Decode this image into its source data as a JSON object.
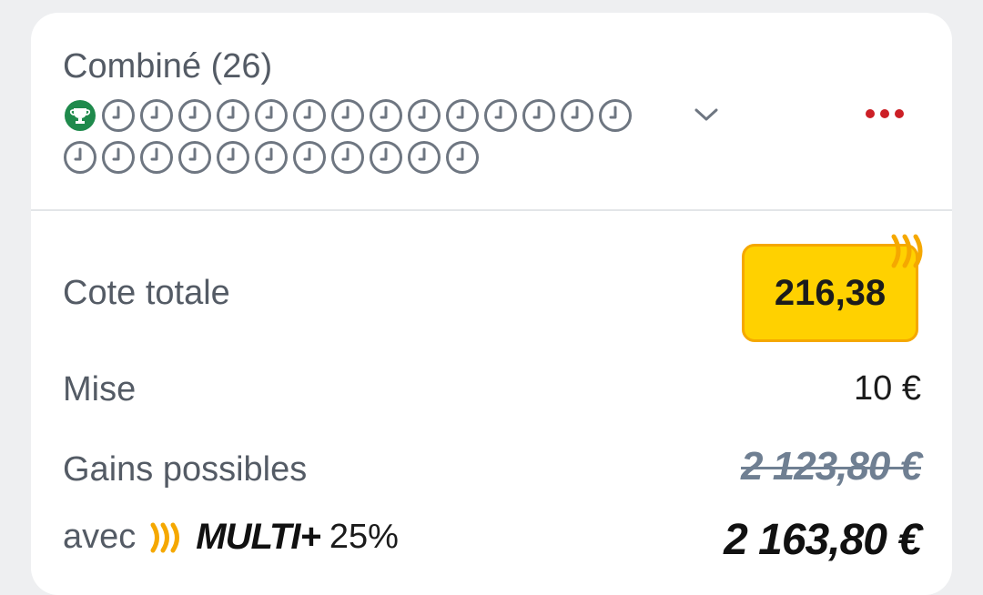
{
  "slip": {
    "title": "Combiné (26)",
    "status_rows": [
      [
        "trophy-icon",
        "clock-icon",
        "clock-icon",
        "clock-icon",
        "clock-icon",
        "clock-icon",
        "clock-icon",
        "clock-icon",
        "clock-icon",
        "clock-icon",
        "clock-icon",
        "clock-icon",
        "clock-icon",
        "clock-icon",
        "clock-icon"
      ],
      [
        "clock-icon",
        "clock-icon",
        "clock-icon",
        "clock-icon",
        "clock-icon",
        "clock-icon",
        "clock-icon",
        "clock-icon",
        "clock-icon",
        "clock-icon",
        "clock-icon"
      ]
    ],
    "expand_icon": "chevron-down-icon",
    "more_icon": "more-dots-icon"
  },
  "summary": {
    "odds_label": "Cote totale",
    "odds_value": "216,38",
    "stake_label": "Mise",
    "stake_value": "10 €",
    "gains_label": "Gains possibles",
    "gains_old": "2 123,80 €",
    "boost_prefix": "avec",
    "boost_brand": "MULTI+",
    "boost_percent": "25%",
    "gains_new": "2 163,80 €"
  },
  "colors": {
    "accent_red": "#cc1f26",
    "boost_yellow": "#ffd100",
    "boost_orange": "#f5a800",
    "win_green": "#1f8a4c",
    "pending_gray": "#6e7681"
  }
}
